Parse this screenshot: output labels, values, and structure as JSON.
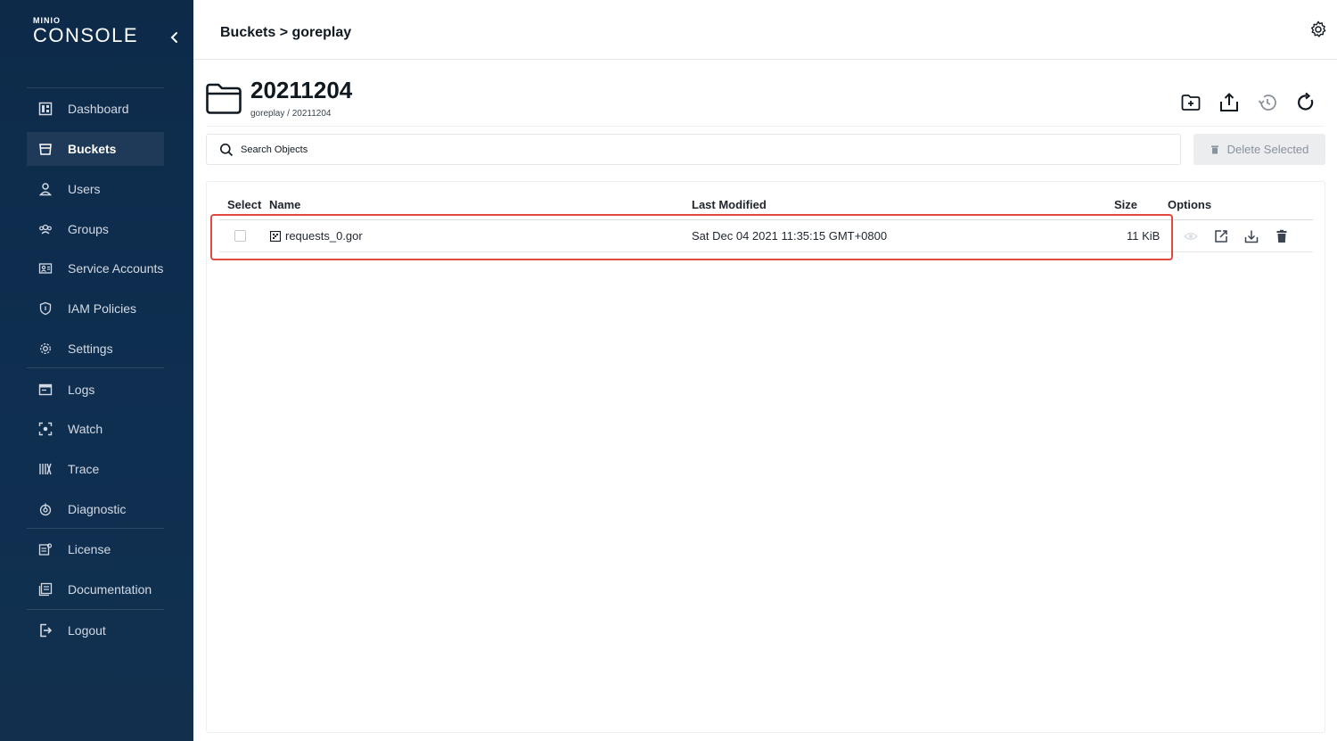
{
  "app": {
    "brand_top": "MINIO",
    "brand_main": "CONSOLE"
  },
  "sidebar": {
    "items": [
      {
        "label": "Dashboard",
        "icon": "dashboard-icon",
        "active": false
      },
      {
        "label": "Buckets",
        "icon": "bucket-icon",
        "active": true
      },
      {
        "label": "Users",
        "icon": "user-icon",
        "active": false
      },
      {
        "label": "Groups",
        "icon": "groups-icon",
        "active": false
      },
      {
        "label": "Service Accounts",
        "icon": "service-accounts-icon",
        "active": false
      },
      {
        "label": "IAM Policies",
        "icon": "shield-icon",
        "active": false
      },
      {
        "label": "Settings",
        "icon": "gear-icon",
        "active": false
      },
      {
        "label": "Logs",
        "icon": "logs-icon",
        "active": false
      },
      {
        "label": "Watch",
        "icon": "watch-icon",
        "active": false
      },
      {
        "label": "Trace",
        "icon": "trace-icon",
        "active": false
      },
      {
        "label": "Diagnostic",
        "icon": "diagnostic-icon",
        "active": false
      },
      {
        "label": "License",
        "icon": "license-icon",
        "active": false
      },
      {
        "label": "Documentation",
        "icon": "documentation-icon",
        "active": false
      },
      {
        "label": "Logout",
        "icon": "logout-icon",
        "active": false
      }
    ]
  },
  "header": {
    "breadcrumb": "Buckets > goreplay"
  },
  "folder": {
    "title": "20211204",
    "path": "goreplay / 20211204"
  },
  "search": {
    "placeholder": "Search Objects"
  },
  "toolbar": {
    "delete_selected_label": "Delete Selected"
  },
  "table": {
    "columns": {
      "select": "Select",
      "name": "Name",
      "last_modified": "Last Modified",
      "size": "Size",
      "options": "Options"
    },
    "rows": [
      {
        "name": "requests_0.gor",
        "last_modified": "Sat Dec 04 2021 11:35:15 GMT+0800",
        "size": "11 KiB"
      }
    ]
  },
  "colors": {
    "sidebar_bg": "#0f2f51",
    "highlight": "#e0493e",
    "accent": "#101820"
  }
}
